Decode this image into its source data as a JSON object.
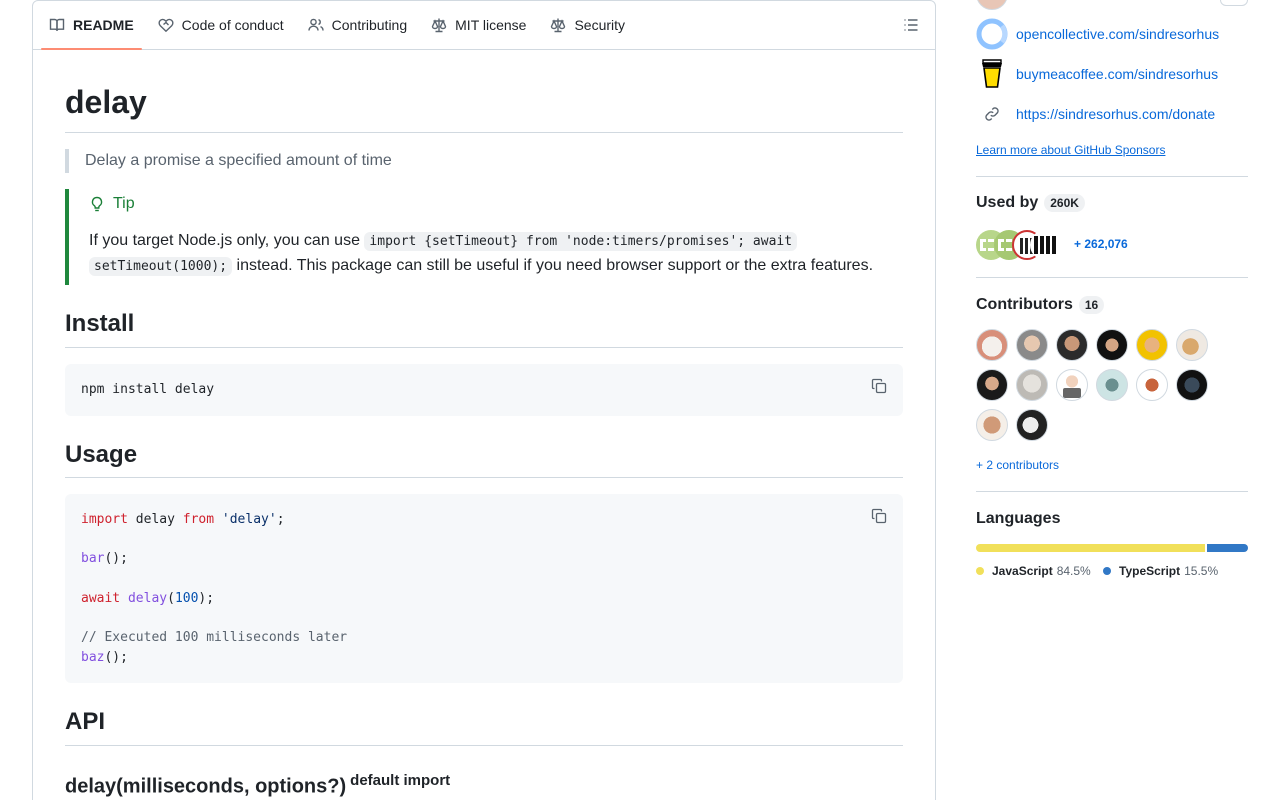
{
  "tabs": [
    {
      "label": "README",
      "icon": "book-icon",
      "active": true
    },
    {
      "label": "Code of conduct",
      "icon": "heart-handshake-icon"
    },
    {
      "label": "Contributing",
      "icon": "people-icon"
    },
    {
      "label": "MIT license",
      "icon": "law-scale-icon"
    },
    {
      "label": "Security",
      "icon": "law-scale-icon"
    }
  ],
  "readme": {
    "title": "delay",
    "description": "Delay a promise a specified amount of time",
    "tip": {
      "title": "Tip",
      "text_before": "If you target Node.js only, you can use ",
      "code1": "import {setTimeout} from 'node:timers/promises'; await",
      "code2": "setTimeout(1000);",
      "text_after": " instead. This package can still be useful if you need browser support or the extra features."
    },
    "install_heading": "Install",
    "install_code": "npm install delay",
    "usage_heading": "Usage",
    "usage_code": {
      "line1_kw": "import",
      "line1_mid": " delay ",
      "line1_kw2": "from",
      "line1_str": " 'delay'",
      "line1_end": ";",
      "line2_fn": "bar",
      "line2_end": "();",
      "line3_kw": "await",
      "line3_fn": "delay",
      "line3_open": "(",
      "line3_num": "100",
      "line3_end": ");",
      "line4_cmt": "// Executed 100 milliseconds later",
      "line5_fn": "baz",
      "line5_end": "();"
    },
    "api_heading": "API",
    "api_sub": "delay(milliseconds, options?)",
    "api_badge": "default import"
  },
  "sidebar": {
    "sponsors": [
      {
        "label": "opencollective.com/sindresorhus",
        "icon": "opencollective-icon"
      },
      {
        "label": "buymeacoffee.com/sindresorhus",
        "icon": "coffee-cup-icon"
      },
      {
        "label": "https://sindresorhus.com/donate",
        "icon": "link-icon"
      }
    ],
    "learn_more": "Learn more about GitHub Sponsors",
    "used_by": {
      "title": "Used by",
      "count": "260K",
      "more": "+ 262,076"
    },
    "contributors": {
      "title": "Contributors",
      "count": "16",
      "more": "+ 2 contributors"
    },
    "languages": {
      "title": "Languages",
      "items": [
        {
          "name": "JavaScript",
          "percent": "84.5%",
          "value": 84.5,
          "color": "#f1e05a"
        },
        {
          "name": "TypeScript",
          "percent": "15.5%",
          "value": 15.5,
          "color": "#3178c6"
        }
      ]
    }
  }
}
